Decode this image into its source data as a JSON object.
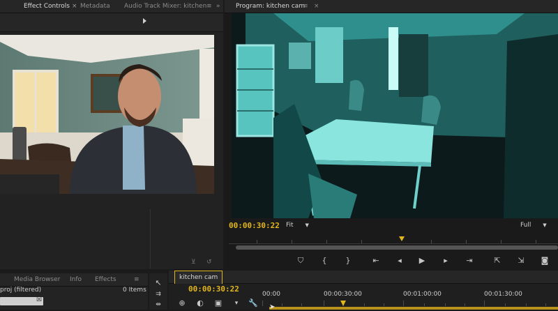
{
  "left_panel": {
    "tabs": [
      {
        "label": "Effect Controls",
        "active": true,
        "closable": true
      },
      {
        "label": "Metadata",
        "active": false,
        "closable": false
      },
      {
        "label": "Audio Track Mixer: kitchen",
        "active": false,
        "closable": false
      }
    ]
  },
  "program_monitor": {
    "tab_label": "Program: kitchen cam",
    "timecode": "00:00:30:22",
    "zoom_select": "Fit",
    "resolution_select": "Full"
  },
  "project_panel": {
    "tabs": [
      {
        "label": "Media Browser"
      },
      {
        "label": "Info"
      },
      {
        "label": "Effects"
      }
    ],
    "filter_text": "proj (filtered)",
    "item_count": "0 Items"
  },
  "timeline": {
    "tab_label": "kitchen cam",
    "timecode": "00:00:30:22",
    "ruler_labels": [
      "00:00",
      "00:00:30:00",
      "00:01:00:00",
      "00:01:30:00"
    ]
  },
  "colors": {
    "timecode": "#e2b61d",
    "night_vision": "#2aa7a4",
    "playhead": "#e2b61d"
  },
  "icons": {
    "transport": [
      "marker-icon",
      "mark-in-icon",
      "mark-out-icon",
      "go-to-in-icon",
      "step-back-icon",
      "play-icon",
      "step-forward-icon",
      "go-to-out-icon",
      "lift-icon",
      "extract-icon",
      "camera-icon"
    ]
  }
}
